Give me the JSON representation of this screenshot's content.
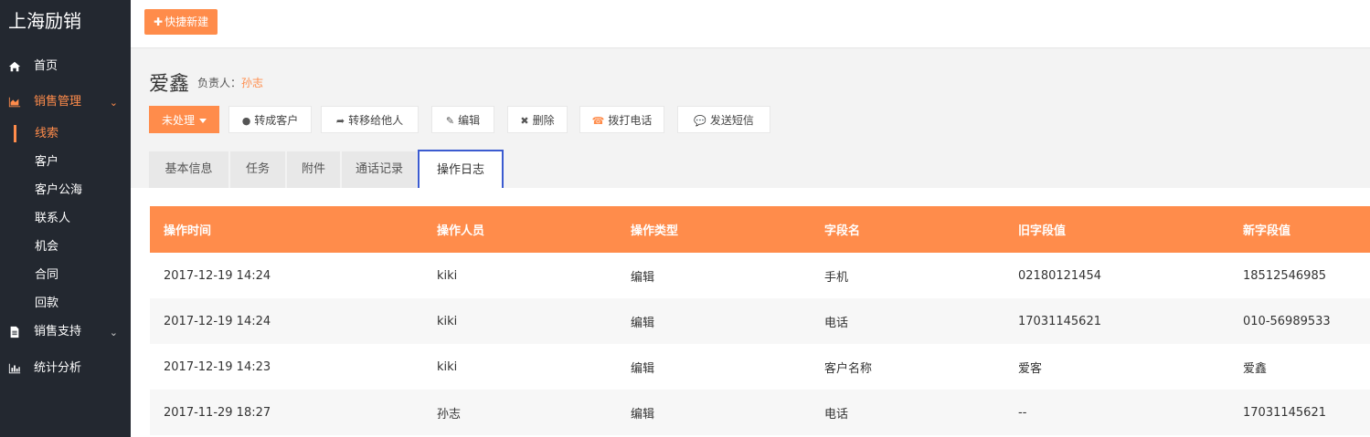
{
  "brand": "上海励销",
  "sidebar": {
    "items": [
      {
        "label": "首页",
        "icon": "home-icon"
      },
      {
        "label": "销售管理",
        "icon": "area-chart-icon"
      },
      {
        "label": "销售支持",
        "icon": "file-icon"
      },
      {
        "label": "统计分析",
        "icon": "bar-chart-icon"
      }
    ],
    "sales_sub": [
      "线索",
      "客户",
      "客户公海",
      "联系人",
      "机会",
      "合同",
      "回款"
    ]
  },
  "topbar": {
    "quick_new": "快捷新建"
  },
  "record": {
    "title": "爱鑫",
    "owner_label": "负责人：",
    "owner_name": "孙志"
  },
  "actions": {
    "status": "未处理",
    "convert": "转成客户",
    "transfer": "转移给他人",
    "edit": "编辑",
    "delete": "删除",
    "call": "拨打电话",
    "sms": "发送短信"
  },
  "tabs": [
    "基本信息",
    "任务",
    "附件",
    "通话记录",
    "操作日志"
  ],
  "table": {
    "headers": [
      "操作时间",
      "操作人员",
      "操作类型",
      "字段名",
      "旧字段值",
      "新字段值"
    ],
    "rows": [
      [
        "2017-12-19 14:24",
        "kiki",
        "编辑",
        "手机",
        "02180121454",
        "18512546985"
      ],
      [
        "2017-12-19 14:24",
        "kiki",
        "编辑",
        "电话",
        "17031145621",
        "010-56989533"
      ],
      [
        "2017-12-19 14:23",
        "kiki",
        "编辑",
        "客户名称",
        "爱客",
        "爱鑫"
      ],
      [
        "2017-11-29 18:27",
        "孙志",
        "编辑",
        "电话",
        "--",
        "17031145621"
      ]
    ]
  },
  "colors": {
    "accent": "#ff8c4b",
    "sidebar": "#232830",
    "tab_focus": "#3b5bd0"
  }
}
